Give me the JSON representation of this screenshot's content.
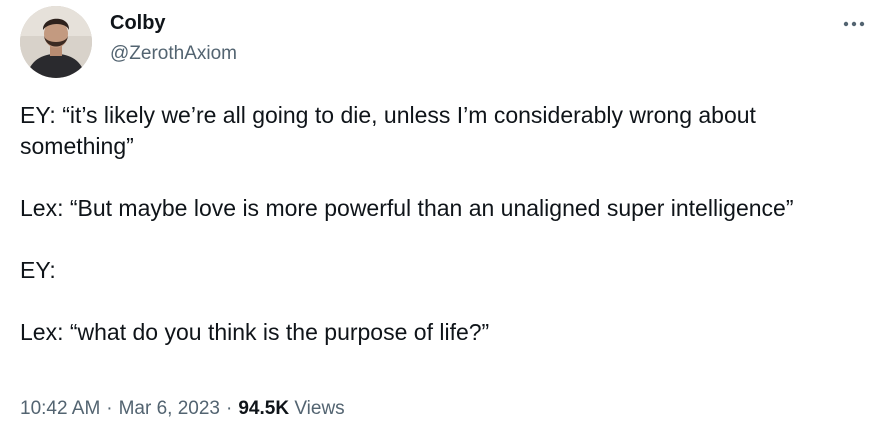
{
  "author": {
    "name": "Colby",
    "handle": "@ZerothAxiom"
  },
  "tweet": {
    "paragraphs": [
      "EY: “it’s likely we’re all going to die, unless I’m considerably wrong about something”",
      "Lex: “But maybe love is more powerful than an unaligned super intelligence”",
      "EY:",
      "Lex: “what do you think is the purpose of life?”"
    ]
  },
  "meta": {
    "time": "10:42 AM",
    "separator": "·",
    "date": "Mar 6, 2023",
    "views_count": "94.5K",
    "views_label": "Views"
  },
  "icons": {
    "more": "more-horizontal-icon"
  },
  "colors": {
    "text_primary": "#0f1419",
    "text_secondary": "#536471"
  }
}
